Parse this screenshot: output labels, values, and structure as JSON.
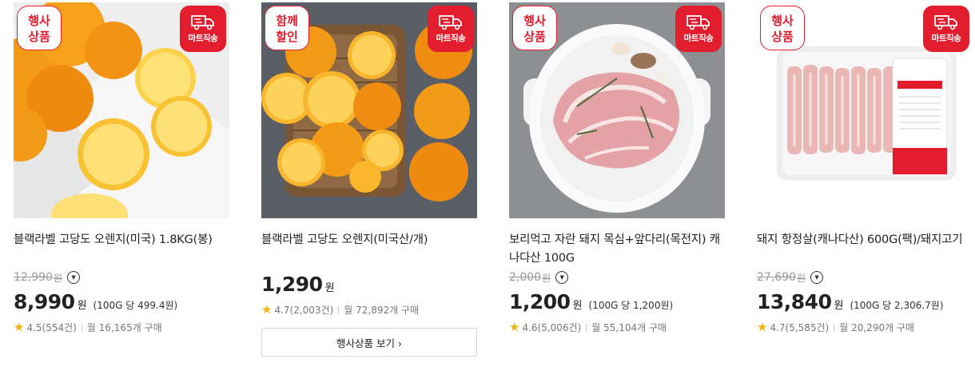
{
  "products": [
    {
      "badge": "행사\n상품",
      "mart_label": "마트직송",
      "title": "블랙라벨 고당도 오렌지(미국) 1.8KG(봉)",
      "original_price": "12,990",
      "original_won": "원",
      "price": "8,990",
      "won": "원",
      "unit_price": "(100G 당 499.4원)",
      "rating": "4.5(554건)",
      "sales": "월 16,165개 구매"
    },
    {
      "badge": "함께\n할인",
      "mart_label": "마트직송",
      "title": "블랙라벨 고당도 오렌지(미국산/개)",
      "price": "1,290",
      "won": "원",
      "rating": "4.7(2,003건)",
      "sales": "월 72,892개 구매",
      "event_button": "행사상품 보기 ›"
    },
    {
      "badge": "행사\n상품",
      "mart_label": "마트직송",
      "title": "보리먹고 자란 돼지 목심+앞다리(목전지) 캐나다산 100G",
      "original_price": "2,000",
      "original_won": "원",
      "price": "1,200",
      "won": "원",
      "unit_price": "(100G 당 1,200원)",
      "rating": "4.6(5,006건)",
      "sales": "월 55,104개 구매"
    },
    {
      "badge": "행사\n상품",
      "mart_label": "마트직송",
      "title": "돼지 항정살(캐나다산) 600G(팩)/돼지고기",
      "original_price": "27,690",
      "original_won": "원",
      "price": "13,840",
      "won": "원",
      "unit_price": "(100G 당 2,306.7원)",
      "rating": "4.7(5,585건)",
      "sales": "월 20,290개 구매"
    }
  ],
  "colors": {
    "accent": "#e11d2e",
    "star": "#f5b301"
  },
  "icons": {
    "mart": "delivery-truck-icon",
    "info": "chevron-down-circle-icon",
    "star": "star-icon"
  }
}
